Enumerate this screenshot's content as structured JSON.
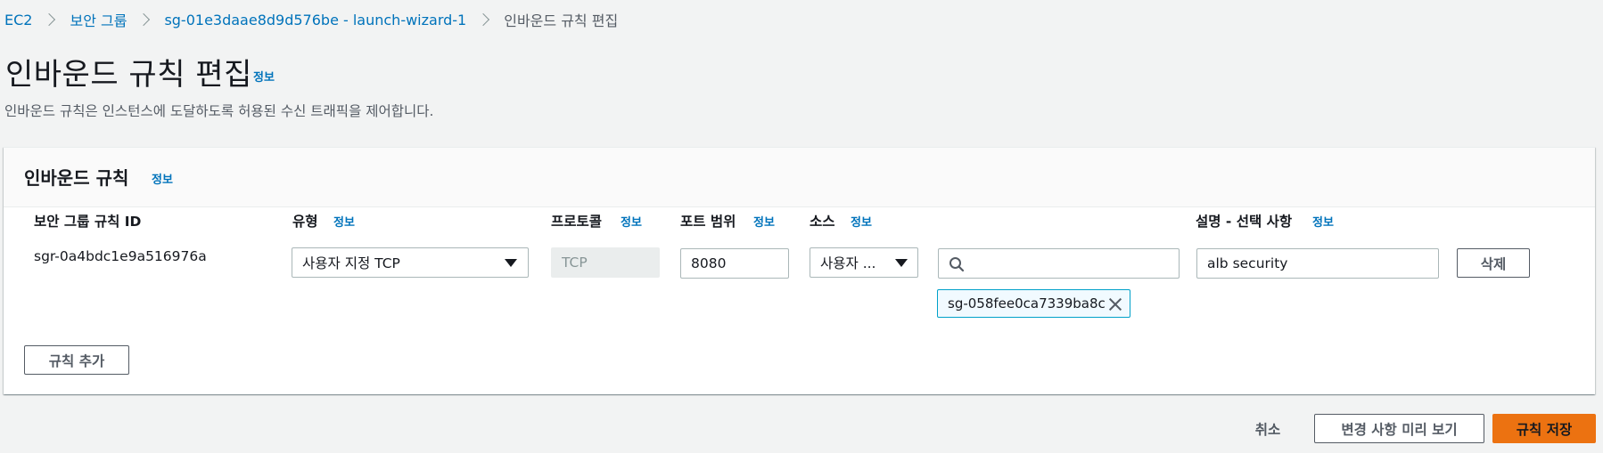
{
  "breadcrumb": [
    {
      "label": "EC2"
    },
    {
      "label": "보안 그룹"
    },
    {
      "label": "sg-01e3daae8d9d576be - launch-wizard-1"
    },
    {
      "label": "인바운드 규칙 편집"
    }
  ],
  "page": {
    "title": "인바운드 규칙 편집",
    "info": "정보",
    "description": "인바운드 규칙은 인스턴스에 도달하도록 허용된 수신 트래픽을 제어합니다."
  },
  "card": {
    "title": "인바운드 규칙",
    "info": "정보"
  },
  "columns": {
    "rule_id": "보안 그룹 규칙 ID",
    "type": "유형",
    "protocol": "프로토콜",
    "port_range": "포트 범위",
    "source": "소스",
    "description": "설명 - 선택 사항",
    "info": "정보"
  },
  "rule": {
    "id": "sgr-0a4bdc1e9a516976a",
    "type": "사용자 지정 TCP",
    "protocol": "TCP",
    "port": "8080",
    "source": "사용자 ...",
    "search_value": "",
    "token": "sg-058fee0ca7339ba8c",
    "description": "alb security",
    "delete_label": "삭제"
  },
  "add_rule_label": "규칙 추가",
  "footer": {
    "cancel": "취소",
    "preview": "변경 사항 미리 보기",
    "save": "규칙 저장"
  },
  "colors": {
    "link": "#0073bb",
    "primary": "#ec7211",
    "background": "#f2f3f3",
    "token_border": "#00a1c9"
  }
}
